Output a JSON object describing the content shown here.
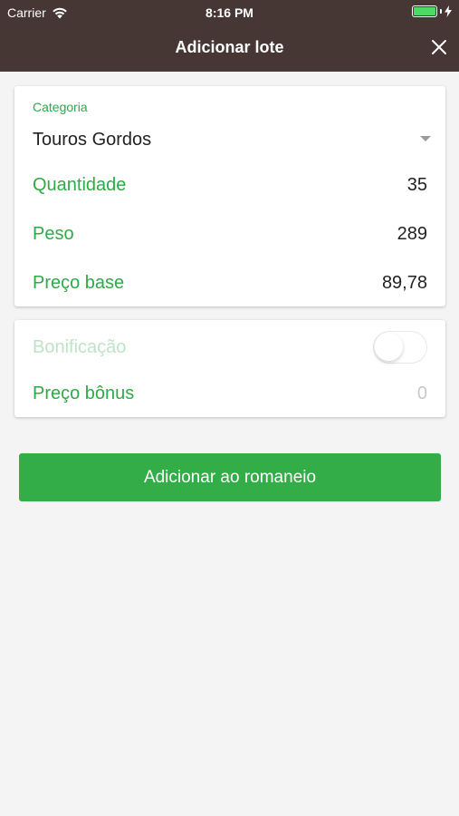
{
  "status_bar": {
    "carrier": "Carrier",
    "time": "8:16 PM",
    "wifi_icon": "wifi-icon",
    "battery_icon": "battery-icon",
    "charging_icon": "bolt-icon"
  },
  "nav": {
    "title": "Adicionar lote",
    "close_icon": "close-icon"
  },
  "form": {
    "category_label": "Categoria",
    "category_value": "Touros Gordos",
    "quantity_label": "Quantidade",
    "quantity_value": "35",
    "weight_label": "Peso",
    "weight_value": "289",
    "base_price_label": "Preço base",
    "base_price_value": "89,78"
  },
  "bonus": {
    "bonus_label": "Bonificação",
    "bonus_enabled": false,
    "bonus_price_label": "Preço bônus",
    "bonus_price_value": "0"
  },
  "actions": {
    "submit_label": "Adicionar ao romaneio"
  },
  "colors": {
    "header_bg": "#463634",
    "accent_green": "#33ad47",
    "label_green": "#2eaa47",
    "page_bg": "#f4f4f4"
  }
}
